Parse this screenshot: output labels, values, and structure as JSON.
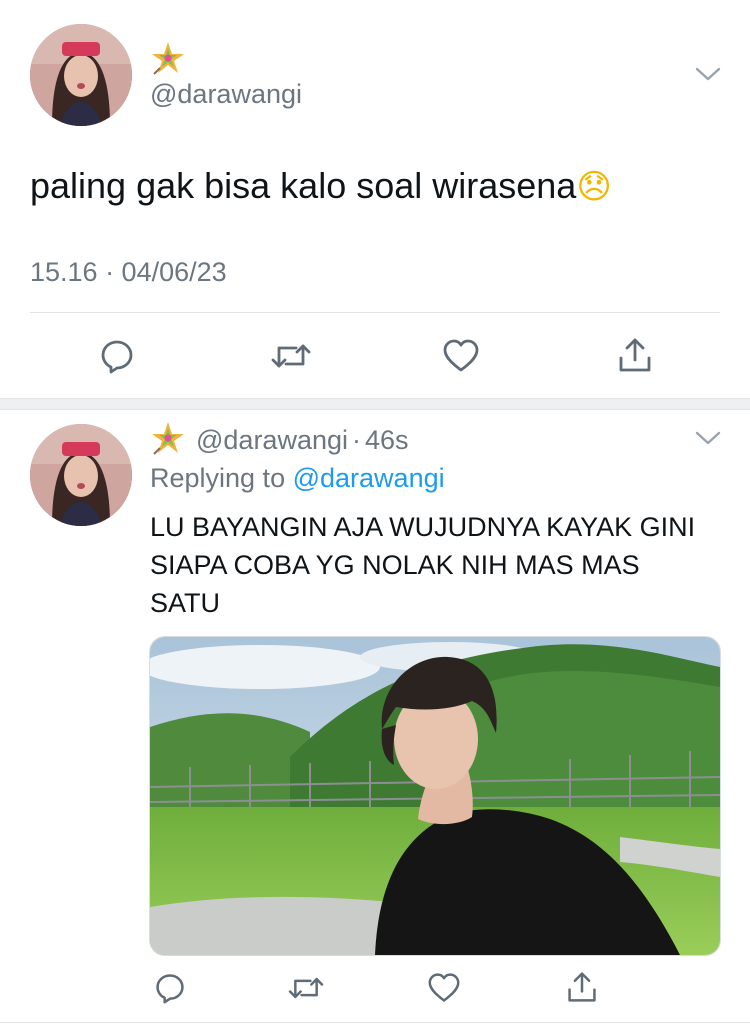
{
  "main_tweet": {
    "handle": "@darawangi",
    "text": "paling gak bisa kalo soal wirasena",
    "emoji": "😞",
    "timestamp": "15.16 · 04/06/23"
  },
  "reply_tweet": {
    "handle": "@darawangi",
    "separator": "·",
    "time": "46s",
    "replying_prefix": "Replying to",
    "replying_handle": "@darawangi",
    "text": "LU BAYANGIN AJA WUJUDNYA KAYAK GINI SIAPA COBA YG NOLAK NIH MAS MAS SATU"
  },
  "icons": {
    "badge": "pinwheel-star-icon",
    "menu": "chevron-down-icon",
    "reply": "reply-icon",
    "retweet": "retweet-icon",
    "like": "heart-icon",
    "share": "share-icon"
  },
  "colors": {
    "text": "#0f1419",
    "muted": "#6b7681",
    "link": "#1d9bf0",
    "divider": "#e1e5e8"
  }
}
